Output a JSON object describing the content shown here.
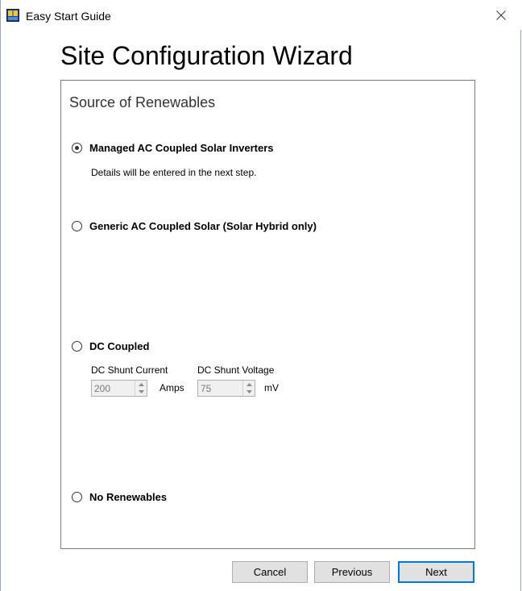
{
  "window": {
    "title": "Easy Start Guide",
    "icon": "app-icon",
    "close_icon": "close-icon"
  },
  "heading": "Site Configuration Wizard",
  "panel": {
    "title": "Source of Renewables",
    "options": [
      {
        "label": "Managed AC Coupled Solar Inverters",
        "selected": true,
        "note": "Details will be entered in the next step."
      },
      {
        "label": "Generic AC Coupled Solar (Solar Hybrid only)",
        "selected": false
      },
      {
        "label": "DC Coupled",
        "selected": false
      },
      {
        "label": "No Renewables",
        "selected": false
      }
    ],
    "dc": {
      "shunt_current_label": "DC Shunt Current",
      "shunt_voltage_label": "DC Shunt Voltage",
      "current_value": "200",
      "current_unit": "Amps",
      "voltage_value": "75",
      "voltage_unit": "mV"
    }
  },
  "buttons": {
    "cancel": "Cancel",
    "previous": "Previous",
    "next": "Next"
  },
  "colors": {
    "accent": "#0078d7",
    "button_bg": "#e1e1e1",
    "disabled_field_bg": "#f0f0f0"
  }
}
